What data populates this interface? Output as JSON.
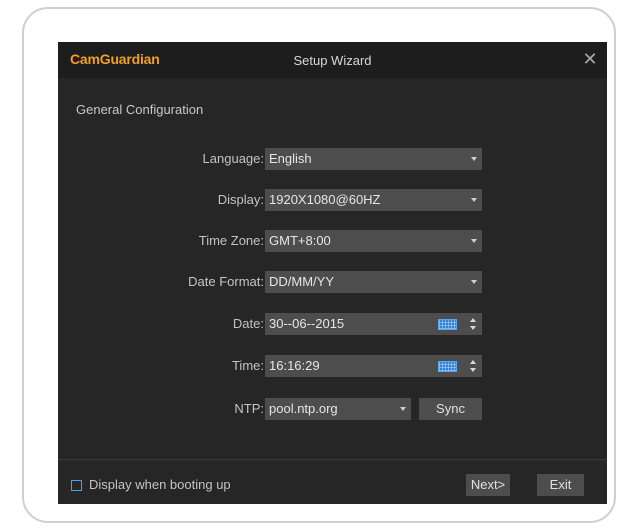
{
  "app": {
    "brand_first": "C",
    "brand_rest": "amGuardian",
    "window_title": "Setup Wizard"
  },
  "section_title": "General Configuration",
  "fields": {
    "language": {
      "label": "Language:",
      "value": "English"
    },
    "display": {
      "label": "Display:",
      "value": "1920X1080@60HZ"
    },
    "timezone": {
      "label": "Time Zone:",
      "value": "GMT+8:00"
    },
    "date_format": {
      "label": "Date Format:",
      "value": "DD/MM/YY"
    },
    "date": {
      "label": "Date:",
      "value": "30--06--2015"
    },
    "time": {
      "label": "Time:",
      "value": "16:16:29"
    },
    "ntp": {
      "label": "NTP:",
      "value": "pool.ntp.org"
    }
  },
  "buttons": {
    "sync": "Sync",
    "next": "Next>",
    "exit": "Exit",
    "close": "✕"
  },
  "footer": {
    "checkbox_label": "Display when booting up",
    "checkbox_checked": false
  },
  "colors": {
    "brand_accent": "#ff9a1a",
    "checkbox_accent": "#3fa4ff",
    "keyboard_icon": "#2f83d6",
    "dialog_bg": "#262626",
    "field_bg": "#4d4d4d"
  },
  "icons": [
    "close-icon",
    "dropdown-caret-icon",
    "keyboard-icon",
    "spinner-icon",
    "checkbox-icon"
  ]
}
